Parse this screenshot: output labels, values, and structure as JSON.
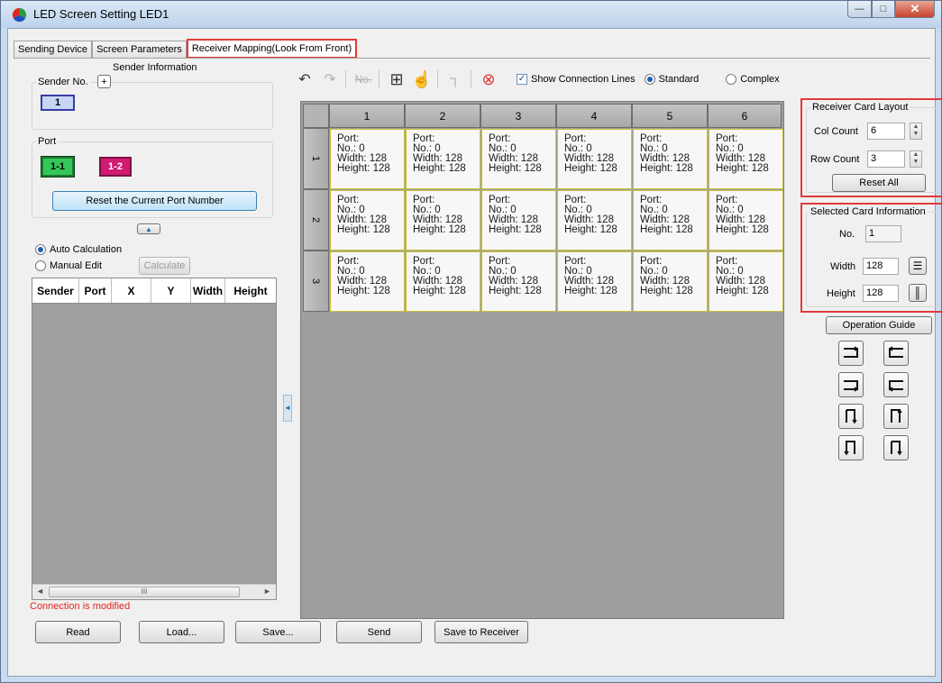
{
  "window": {
    "title": "LED Screen Setting LED1"
  },
  "tabs": [
    {
      "label": "Sending Device"
    },
    {
      "label": "Screen Parameters"
    },
    {
      "label": "Receiver Mapping(Look From Front)"
    }
  ],
  "sender_panel": {
    "title": "Sender Information",
    "sender_no_label": "Sender No.",
    "add_symbol": "+",
    "sender_value": "1",
    "port_label": "Port",
    "ports": [
      "1-1",
      "1-2"
    ],
    "reset_port_label": "Reset the Current Port Number",
    "auto_calc_label": "Auto Calculation",
    "manual_edit_label": "Manual Edit",
    "calculate_label": "Calculate",
    "table_columns": [
      "Sender",
      "Port",
      "X",
      "Y",
      "Width",
      "Height"
    ],
    "scroll_mark": "III"
  },
  "toolbar": {
    "show_lines_label": "Show Connection Lines",
    "standard_label": "Standard",
    "complex_label": "Complex",
    "numbering_icon": "No."
  },
  "grid": {
    "columns": [
      "1",
      "2",
      "3",
      "4",
      "5",
      "6"
    ],
    "rows": [
      "1",
      "2",
      "3"
    ],
    "card": {
      "port": "Port:",
      "no": "No.: 0",
      "width": "Width: 128",
      "height": "Height: 128"
    }
  },
  "receiver_layout": {
    "title": "Receiver Card Layout",
    "col_label": "Col Count",
    "col_value": "6",
    "row_label": "Row Count",
    "row_value": "3",
    "reset_all_label": "Reset All"
  },
  "selected_card": {
    "title": "Selected Card Information",
    "no_label": "No.",
    "no_value": "1",
    "width_label": "Width",
    "width_value": "128",
    "height_label": "Height",
    "height_value": "128"
  },
  "operation_guide_label": "Operation Guide",
  "status": {
    "message": "Connection is modified",
    "color": "#e8231c"
  },
  "bottom_buttons": [
    "Read",
    "Load...",
    "Save...",
    "Send",
    "Save to Receiver"
  ]
}
